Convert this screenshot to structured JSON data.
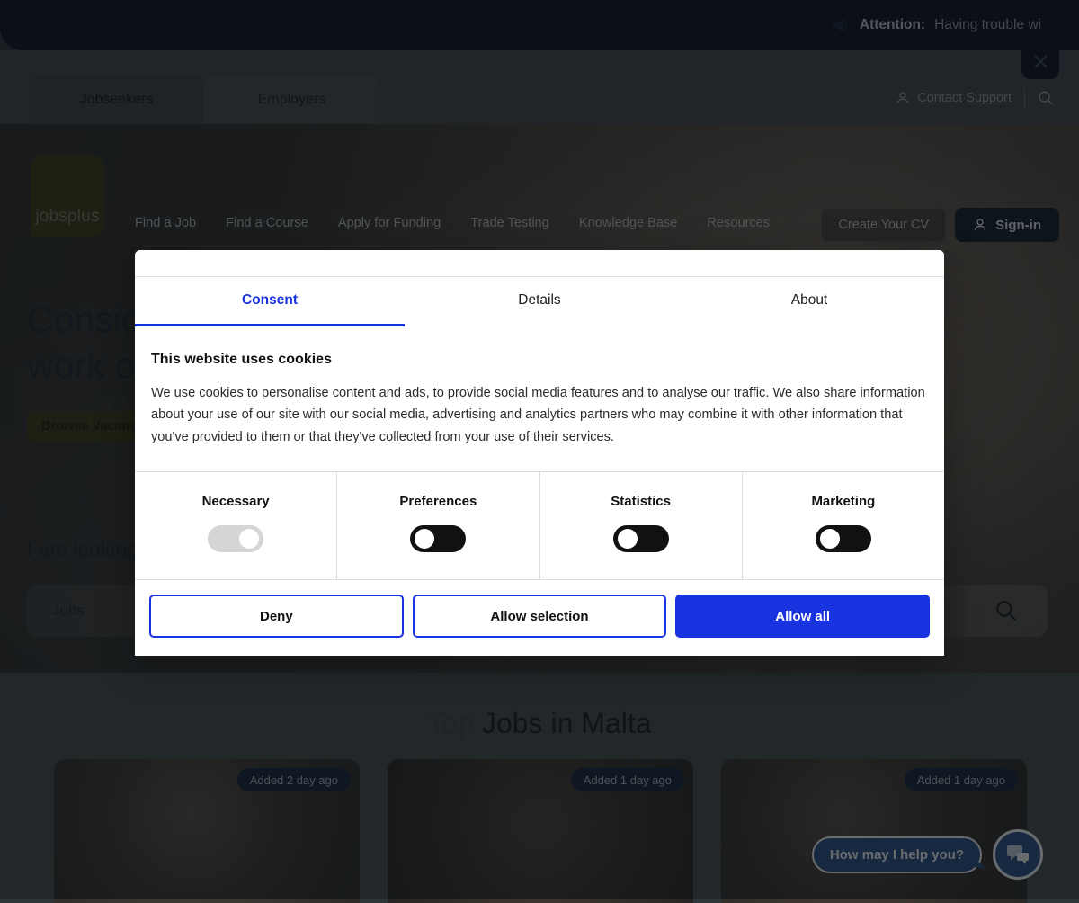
{
  "announcement": {
    "icon": "megaphone-icon",
    "label": "Attention:",
    "text": "Having trouble wi",
    "close_icon": "close-icon"
  },
  "audience_tabs": [
    {
      "label": "Jobseekers",
      "active": true
    },
    {
      "label": "Employers",
      "active": false
    }
  ],
  "utility_nav": {
    "support_label": "Contact Support",
    "support_icon": "user-support-icon",
    "search_icon": "search-icon"
  },
  "brand": {
    "logo_text": "jobsplus",
    "logo_color": "#3c3a10"
  },
  "main_nav": [
    {
      "label": "Find a Job"
    },
    {
      "label": "Find a Course"
    },
    {
      "label": "Apply for Funding"
    },
    {
      "label": "Trade Testing"
    },
    {
      "label": "Knowledge Base"
    },
    {
      "label": "Resources"
    }
  ],
  "cta": {
    "create_cv": "Create Your CV",
    "sign_in": "Sign-in",
    "sign_in_icon": "user-icon"
  },
  "hero": {
    "line1": "Conside",
    "line2": "work op",
    "browse_label": "Browse Vacancies"
  },
  "search": {
    "heading": "I am looking",
    "type_value": "Jobs",
    "search_icon": "search-icon"
  },
  "jobs_section": {
    "title_thin": "Top ",
    "title_bold": "Jobs in Malta",
    "cards": [
      {
        "badge": "Added 2 day ago"
      },
      {
        "badge": "Added 1 day ago"
      },
      {
        "badge": "Added 1 day ago"
      }
    ]
  },
  "chat": {
    "bubble_text": "How may I help you?",
    "button_icon": "chat-icon"
  },
  "cookie_modal": {
    "tabs": [
      {
        "label": "Consent",
        "active": true
      },
      {
        "label": "Details",
        "active": false
      },
      {
        "label": "About",
        "active": false
      }
    ],
    "heading": "This website uses cookies",
    "body": "We use cookies to personalise content and ads, to provide social media features and to analyse our traffic. We also share information about your use of our site with our social media, advertising and analytics partners who may combine it with other information that you've provided to them or that they've collected from your use of their services.",
    "categories": [
      {
        "label": "Necessary",
        "state": "on-locked"
      },
      {
        "label": "Preferences",
        "state": "off"
      },
      {
        "label": "Statistics",
        "state": "off"
      },
      {
        "label": "Marketing",
        "state": "off"
      }
    ],
    "actions": {
      "deny": "Deny",
      "allow_selection": "Allow selection",
      "allow_all": "Allow all"
    },
    "accent_color": "#1a33e0"
  }
}
